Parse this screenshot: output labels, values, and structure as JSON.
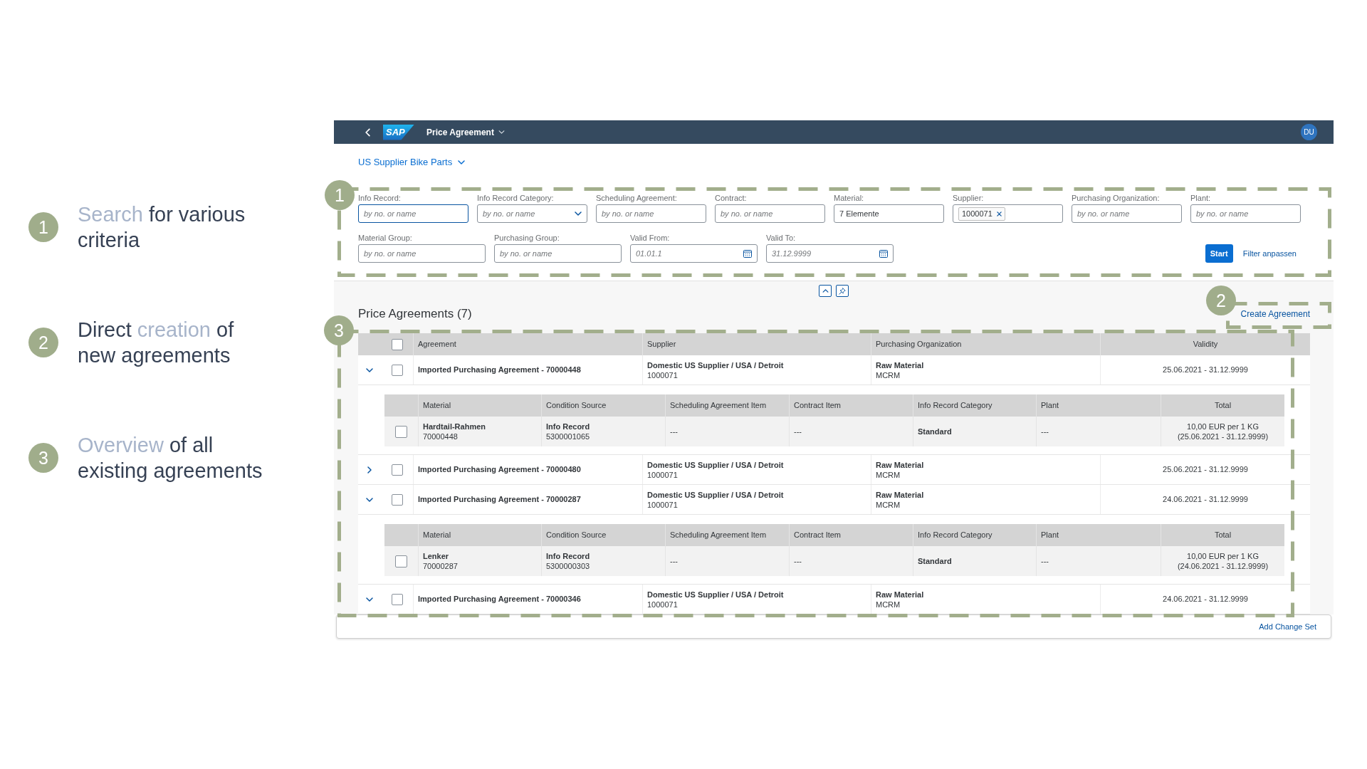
{
  "callouts": [
    {
      "number": "1",
      "lines": [
        [
          {
            "text": "Search",
            "highlight": true
          },
          {
            "text": "for various",
            "highlight": false
          }
        ],
        [
          {
            "text": "criteria",
            "highlight": false
          }
        ]
      ]
    },
    {
      "number": "2",
      "lines": [
        [
          {
            "text": "Direct",
            "highlight": false
          },
          {
            "text": "creation",
            "highlight": true
          },
          {
            "text": "of",
            "highlight": false
          }
        ],
        [
          {
            "text": "new agreements",
            "highlight": false
          }
        ]
      ]
    },
    {
      "number": "3",
      "lines": [
        [
          {
            "text": "Overview",
            "highlight": true
          },
          {
            "text": "of all",
            "highlight": false
          }
        ],
        [
          {
            "text": "existing agreements",
            "highlight": false
          }
        ]
      ]
    }
  ],
  "app": {
    "shell_bar": {
      "logo": "SAP",
      "title": "Price Agreement",
      "user_initials": "DU"
    },
    "variant": "US Supplier Bike Parts",
    "filter_bar": {
      "step": "1",
      "rows": [
        [
          {
            "kind": "text",
            "label": "Info Record:",
            "placeholder": "by no. or name",
            "focused": true
          },
          {
            "kind": "select",
            "label": "Info Record Category:",
            "placeholder": "by no. or name",
            "focused": false
          },
          {
            "kind": "text",
            "label": "Scheduling Agreement:",
            "placeholder": "by no. or name",
            "focused": false
          },
          {
            "kind": "text",
            "label": "Contract:",
            "placeholder": "by no. or name",
            "focused": false
          },
          {
            "kind": "text",
            "label": "Material:",
            "value": "7 Elemente",
            "focused": false
          },
          {
            "kind": "tokens",
            "label": "Supplier:",
            "tokens": [
              "1000071"
            ],
            "focused": false
          },
          {
            "kind": "text",
            "label": "Purchasing Organization:",
            "placeholder": "by no. or name",
            "focused": false
          },
          {
            "kind": "text",
            "label": "Plant:",
            "placeholder": "by no. or name",
            "focused": false
          }
        ],
        [
          {
            "kind": "text",
            "label": "Material Group:",
            "placeholder": "by no. or name",
            "focused": false
          },
          {
            "kind": "text",
            "label": "Purchasing Group:",
            "placeholder": "by no. or name",
            "focused": false
          },
          {
            "kind": "date",
            "label": "Valid From:",
            "placeholder": "01.01.1",
            "focused": false
          },
          {
            "kind": "date",
            "label": "Valid To:",
            "placeholder": "31.12.9999",
            "focused": false
          }
        ]
      ],
      "go_button": "Start",
      "adapt_link": "Filter anpassen"
    },
    "toolbar": {
      "title": "Price Agreements (7)",
      "create_link": "Create Agreement",
      "step": "2"
    },
    "table": {
      "step": "3",
      "select_all": false,
      "columns": [
        "Agreement",
        "Supplier",
        "Purchasing Organization",
        "Validity"
      ],
      "rows": [
        {
          "expanded": true,
          "selected": false,
          "agreement": "Imported Purchasing Agreement - 70000448",
          "supplier": "Domestic US Supplier / USA / Detroit",
          "supplier_id": "1000071",
          "purchasing_org": "Raw Material",
          "purchasing_org_code": "MCRM",
          "validity": "25.06.2021 - 31.12.9999",
          "item_columns": [
            "Material",
            "Condition Source",
            "Scheduling Agreement Item",
            "Contract Item",
            "Info Record Category",
            "Plant",
            "Total"
          ],
          "items": [
            {
              "selected": false,
              "material": "Hardtail-Rahmen",
              "material_no": "70000448",
              "condition_source": "Info Record",
              "condition_no": "5300001065",
              "scheduling_agreement_item": "---",
              "contract_item": "---",
              "info_record_category": "Standard",
              "plant": "---",
              "total": "10,00 EUR per 1 KG",
              "total_validity": "(25.06.2021 - 31.12.9999)"
            }
          ]
        },
        {
          "expanded": false,
          "selected": false,
          "agreement": "Imported Purchasing Agreement - 70000480",
          "supplier": "Domestic US Supplier / USA / Detroit",
          "supplier_id": "1000071",
          "purchasing_org": "Raw Material",
          "purchasing_org_code": "MCRM",
          "validity": "25.06.2021 - 31.12.9999"
        },
        {
          "expanded": true,
          "selected": false,
          "agreement": "Imported Purchasing Agreement - 70000287",
          "supplier": "Domestic US Supplier / USA / Detroit",
          "supplier_id": "1000071",
          "purchasing_org": "Raw Material",
          "purchasing_org_code": "MCRM",
          "validity": "24.06.2021 - 31.12.9999",
          "item_columns": [
            "Material",
            "Condition Source",
            "Scheduling Agreement Item",
            "Contract Item",
            "Info Record Category",
            "Plant",
            "Total"
          ],
          "items": [
            {
              "selected": false,
              "material": "Lenker",
              "material_no": "70000287",
              "condition_source": "Info Record",
              "condition_no": "5300000303",
              "scheduling_agreement_item": "---",
              "contract_item": "---",
              "info_record_category": "Standard",
              "plant": "---",
              "total": "10,00 EUR per 1 KG",
              "total_validity": "(24.06.2021 - 31.12.9999)"
            }
          ]
        },
        {
          "expanded": true,
          "selected": false,
          "agreement": "Imported Purchasing Agreement - 70000346",
          "supplier": "Domestic US Supplier / USA / Detroit",
          "supplier_id": "1000071",
          "purchasing_org": "Raw Material",
          "purchasing_org_code": "MCRM",
          "validity": "24.06.2021 - 31.12.9999"
        }
      ]
    },
    "footer": {
      "link": "Add Change Set"
    }
  }
}
